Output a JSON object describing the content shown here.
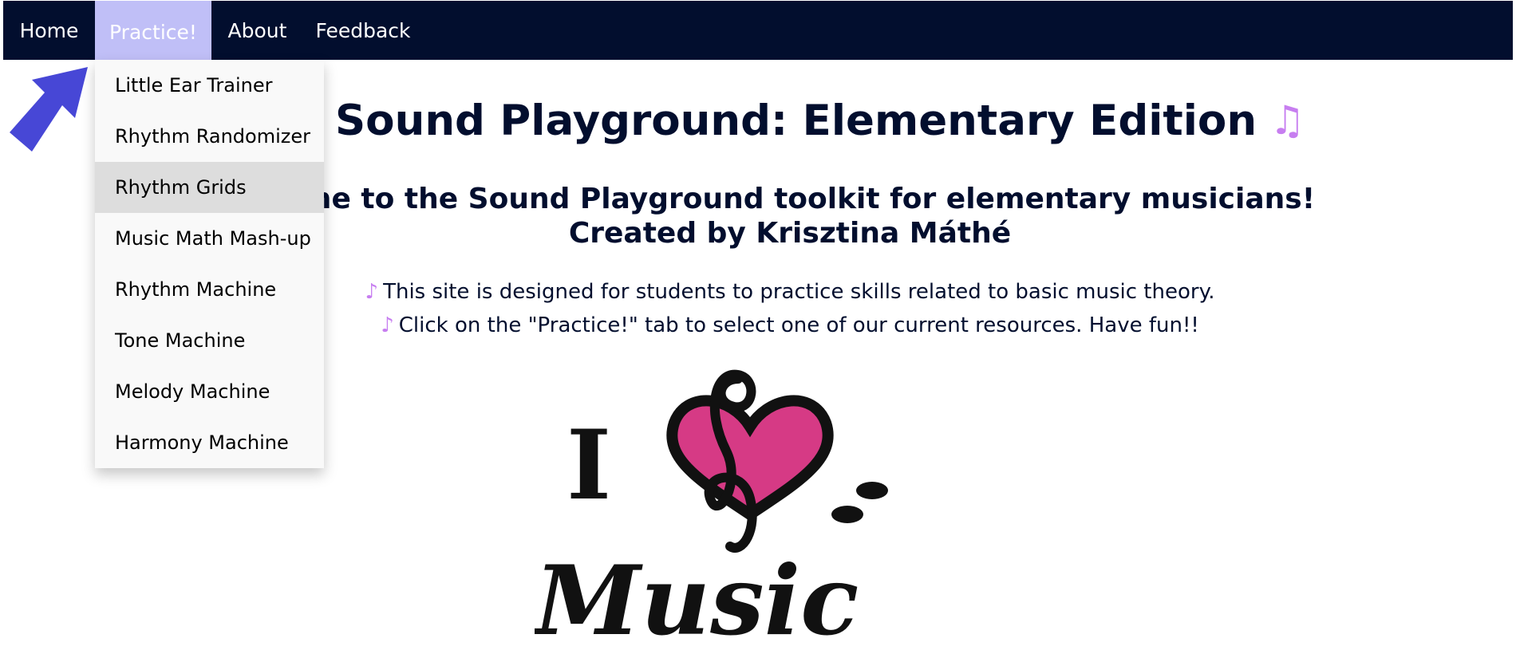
{
  "nav": {
    "home": "Home",
    "practice": "Practice!",
    "about": "About",
    "feedback": "Feedback"
  },
  "dropdown": {
    "items": [
      "Little Ear Trainer",
      "Rhythm Randomizer",
      "Rhythm Grids",
      "Music Math Mash-up",
      "Rhythm Machine",
      "Tone Machine",
      "Melody Machine",
      "Harmony Machine"
    ],
    "hovered_index": 2
  },
  "main": {
    "title": "Sound Playground: Elementary Edition",
    "title_icon": "♫",
    "welcome_line1": "come to the Sound Playground toolkit for elementary musicians!",
    "welcome_line2": "Created by Krisztina Máthé",
    "desc_line1": "This site is designed for students to practice skills related to basic music theory.",
    "desc_line2": "Click on the \"Practice!\" tab to select one of our current resources. Have fun!!",
    "desc_icon": "♪"
  },
  "logo": {
    "letter": "I",
    "word": "Music",
    "heart_color": "#d63a85",
    "ink_color": "#111111"
  },
  "colors": {
    "nav_bg": "#020e2e",
    "nav_active_bg": "#c0bff7",
    "accent": "#c77ef0",
    "arrow": "#4747d6",
    "title": "#020e2e"
  }
}
